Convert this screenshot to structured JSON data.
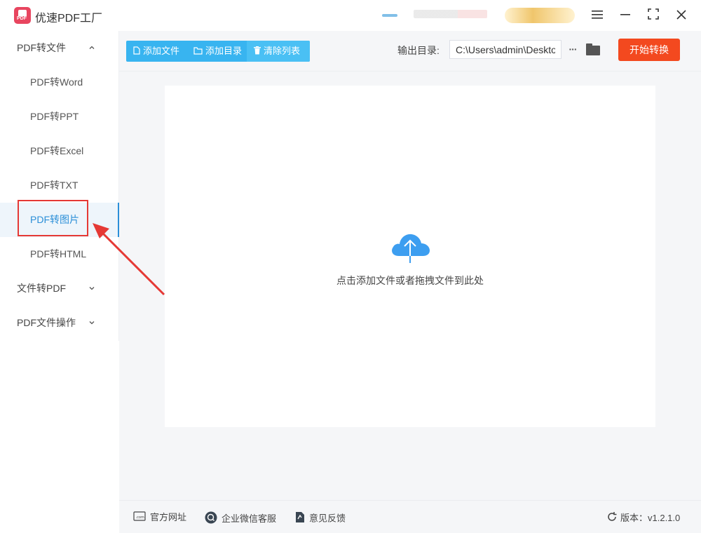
{
  "app": {
    "title": "优速PDF工厂"
  },
  "window_controls": {
    "menu_icon": "hamburger-icon",
    "minimize_icon": "minimize-icon",
    "maximize_icon": "maximize-icon",
    "close_icon": "close-icon"
  },
  "sidebar": {
    "groups": [
      {
        "label": "PDF转文件",
        "chevron": "^",
        "expanded": true
      },
      {
        "label": "文件转PDF",
        "chevron": "⌄",
        "expanded": false
      },
      {
        "label": "PDF文件操作",
        "chevron": "⌄",
        "expanded": false
      }
    ],
    "items": [
      {
        "label": "PDF转Word"
      },
      {
        "label": "PDF转PPT"
      },
      {
        "label": "PDF转Excel"
      },
      {
        "label": "PDF转TXT"
      },
      {
        "label": "PDF转图片",
        "active": true
      },
      {
        "label": "PDF转HTML"
      }
    ]
  },
  "toolbar": {
    "add_file": "添加文件",
    "add_dir": "添加目录",
    "clear_list": "清除列表",
    "output_label": "输出目录:",
    "output_path": "C:\\Users\\admin\\Desktop",
    "more": "···",
    "start": "开始转换"
  },
  "dropzone": {
    "hint": "点击添加文件或者拖拽文件到此处",
    "icon": "cloud-upload-icon"
  },
  "footer": {
    "site": "官方网址",
    "wechat": "企业微信客服",
    "feedback": "意见反馈",
    "version": "版本：v1.2.1.0"
  },
  "colors": {
    "accent": "#38b4f0",
    "start": "#f3491f",
    "active": "#2b8fd8",
    "annotation": "#e53935"
  }
}
